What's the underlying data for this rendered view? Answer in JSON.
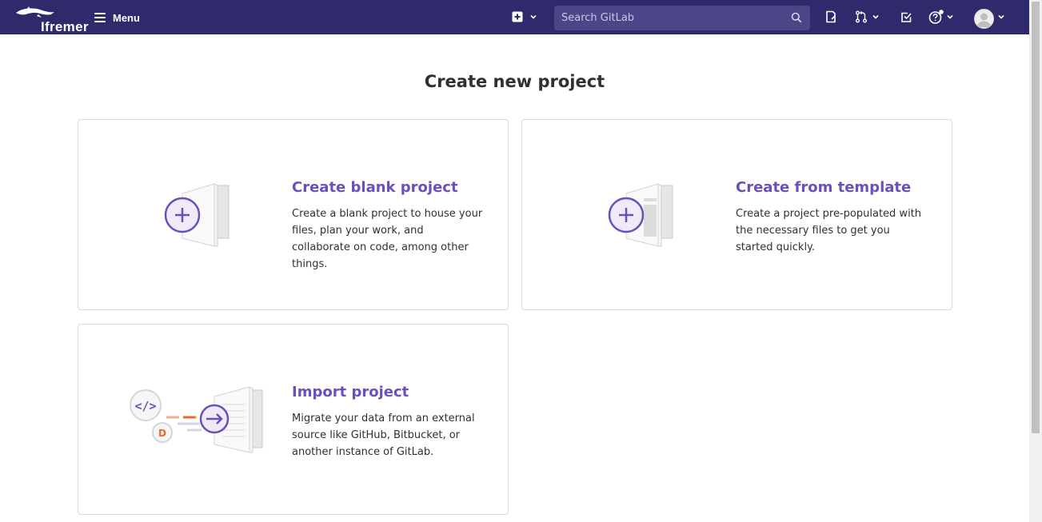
{
  "header": {
    "brand": "Ifremer",
    "menu_label": "Menu",
    "search_placeholder": "Search GitLab",
    "icons": [
      "plus-square-icon",
      "chevron-down-icon",
      "search-icon",
      "issues-icon",
      "merge-request-icon",
      "todo-icon",
      "help-icon",
      "avatar"
    ]
  },
  "main": {
    "title": "Create new project",
    "cards": [
      {
        "title": "Create blank project",
        "description": "Create a blank project to house your files, plan your work, and collaborate on code, among other things.",
        "illustration": "blank-project-illustration"
      },
      {
        "title": "Create from template",
        "description": "Create a project pre-populated with the necessary files to get you started quickly.",
        "illustration": "template-project-illustration"
      },
      {
        "title": "Import project",
        "description": "Migrate your data from an external source like GitHub, Bitbucket, or another instance of GitLab.",
        "illustration": "import-project-illustration"
      }
    ]
  },
  "colors": {
    "navbar": "#2f2a6b",
    "search_bg": "#4a4688",
    "accent": "#6b4fbb",
    "text": "#303030",
    "border": "#dbdbdb"
  }
}
